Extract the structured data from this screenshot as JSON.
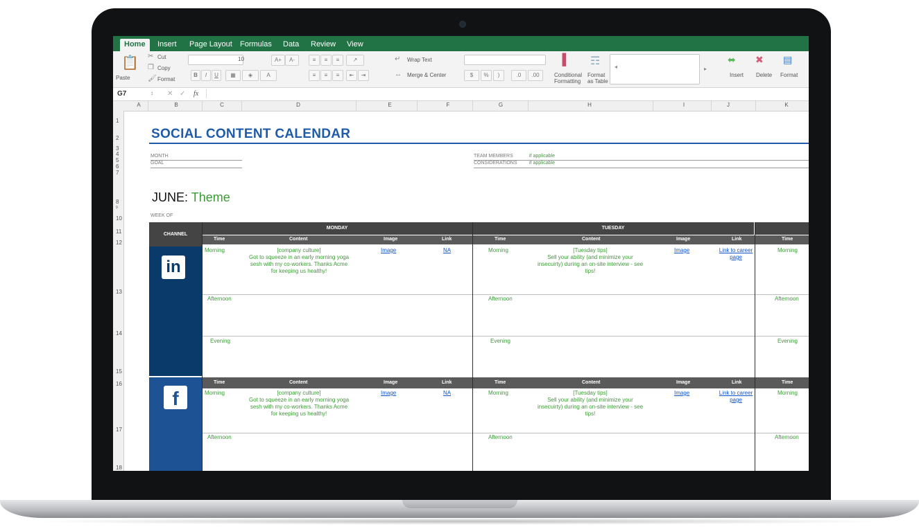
{
  "ribbon": {
    "tabs": [
      "Home",
      "Insert",
      "Page Layout",
      "Formulas",
      "Data",
      "Review",
      "View"
    ],
    "clipboard": {
      "paste": "Paste",
      "cut": "Cut",
      "copy": "Copy",
      "format": "Format"
    },
    "font_size": "10",
    "wrap_text": "Wrap Text",
    "merge_center": "Merge & Center",
    "number_symbols": [
      "$",
      "%",
      ")"
    ],
    "conditional_formatting": [
      "Conditional",
      "Formatting"
    ],
    "format_as_table": [
      "Format",
      "as Table"
    ],
    "cells": [
      "Insert",
      "Delete",
      "Format"
    ]
  },
  "formula_bar": {
    "cell_ref": "G7",
    "fx": "fx"
  },
  "columns": [
    "A",
    "B",
    "C",
    "D",
    "E",
    "F",
    "G",
    "H",
    "I",
    "J",
    "K"
  ],
  "rows": [
    "1",
    "2",
    "3",
    "4",
    "5",
    "6",
    "7",
    "8",
    "9",
    "10",
    "11",
    "12",
    "13",
    "14",
    "15",
    "16",
    "17",
    "18"
  ],
  "sheet": {
    "title": "SOCIAL CONTENT CALENDAR",
    "month_label": "MONTH",
    "goal_label": "GOAL",
    "team_label": "TEAM MEMBERS",
    "team_value": "if applicable",
    "considerations_label": "CONSIDERATIONS",
    "considerations_value": "if applicable",
    "month_name": "JUNE:",
    "theme": "Theme",
    "week_of": "WEEK OF",
    "channel_header": "CHANNEL",
    "days": [
      "MONDAY",
      "TUESDAY"
    ],
    "subheaders": [
      "Time",
      "Content",
      "Image",
      "Link"
    ],
    "linkedin_logo": "in",
    "facebook_logo": "f",
    "morning": "Morning",
    "afternoon": "Afternoon",
    "evening": "Evening",
    "mon_content": [
      "[company culture]",
      "Got to squeeze in an early morning yoga",
      "sesh with my co-workers. Thanks Acme",
      "for keeping us healthy!"
    ],
    "tue_content": [
      "[Tuesday tips]",
      "Sell your ability (and minimize your",
      "insecuirty) during an on-site interview - see",
      "tips!"
    ],
    "image_link": "Image",
    "na_link": "NA",
    "career_link": [
      "Link to career",
      "page"
    ]
  }
}
